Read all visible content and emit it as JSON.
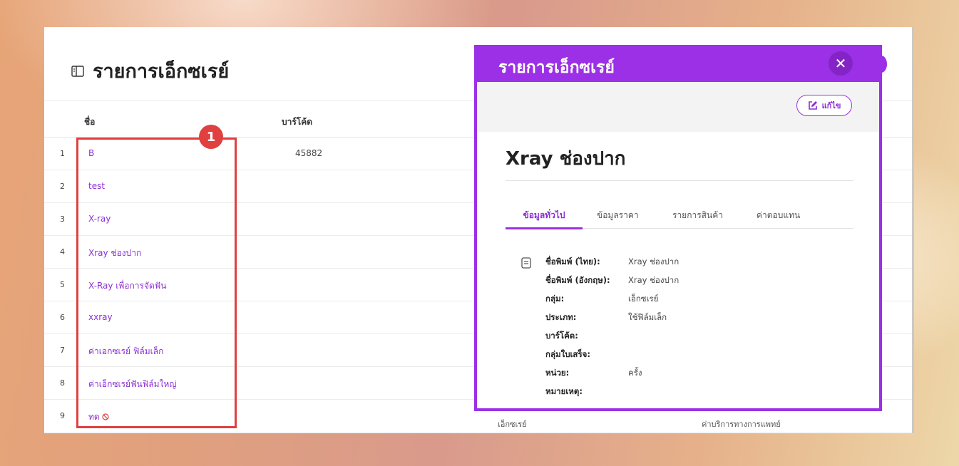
{
  "page": {
    "title": "รายการเอ็กซเรย์",
    "columns": [
      "ชื่อ",
      "บาร์โค้ด"
    ],
    "rows": [
      {
        "num": "1",
        "name": "B",
        "barcode": "45882"
      },
      {
        "num": "2",
        "name": "test",
        "barcode": ""
      },
      {
        "num": "3",
        "name": "X-ray",
        "barcode": ""
      },
      {
        "num": "4",
        "name": "Xray ช่องปาก",
        "barcode": ""
      },
      {
        "num": "5",
        "name": "X-Ray เพื่อการจัดฟัน",
        "barcode": ""
      },
      {
        "num": "6",
        "name": "xxray",
        "barcode": ""
      },
      {
        "num": "7",
        "name": "ค่าเอกซเรย์ ฟิล์มเล็ก",
        "barcode": ""
      },
      {
        "num": "8",
        "name": "ค่าเอ็กซเรย์ฟันฟิล์มใหญ่",
        "barcode": ""
      },
      {
        "num": "9",
        "name": "ทด",
        "barcode": "",
        "group": "เอ็กซเรย์",
        "type": "ค่าบริการทางการแพทย์"
      }
    ]
  },
  "annotation": {
    "badge": "1",
    "color": "#e0403f"
  },
  "modal": {
    "title": "รายการเอ็กซเรย์",
    "close_symbol": "✕",
    "edit_label": "แก้ไข",
    "product_name": "Xray ช่องปาก",
    "tabs": [
      {
        "label": "ข้อมูลทั่วไป",
        "active": true
      },
      {
        "label": "ข้อมูลราคา",
        "active": false
      },
      {
        "label": "รายการสินค้า",
        "active": false
      },
      {
        "label": "ค่าตอบแทน",
        "active": false
      }
    ],
    "details": [
      {
        "label": "ชื่อพิมพ์ (ไทย):",
        "value": "Xray ช่องปาก"
      },
      {
        "label": "ชื่อพิมพ์ (อังกฤษ):",
        "value": "Xray ช่องปาก"
      },
      {
        "label": "กลุ่ม:",
        "value": "เอ็กซเรย์"
      },
      {
        "label": "ประเภท:",
        "value": "ใช้ฟิล์มเล็ก"
      },
      {
        "label": "บาร์โค้ด:",
        "value": ""
      },
      {
        "label": "กลุ่มใบเสร็จ:",
        "value": ""
      },
      {
        "label": "หน่วย:",
        "value": "ครั้ง"
      },
      {
        "label": "หมายเหตุ:",
        "value": ""
      }
    ]
  },
  "colors": {
    "accent": "#9b30e6",
    "link": "#8b2fd3",
    "highlight": "#e0403f"
  }
}
